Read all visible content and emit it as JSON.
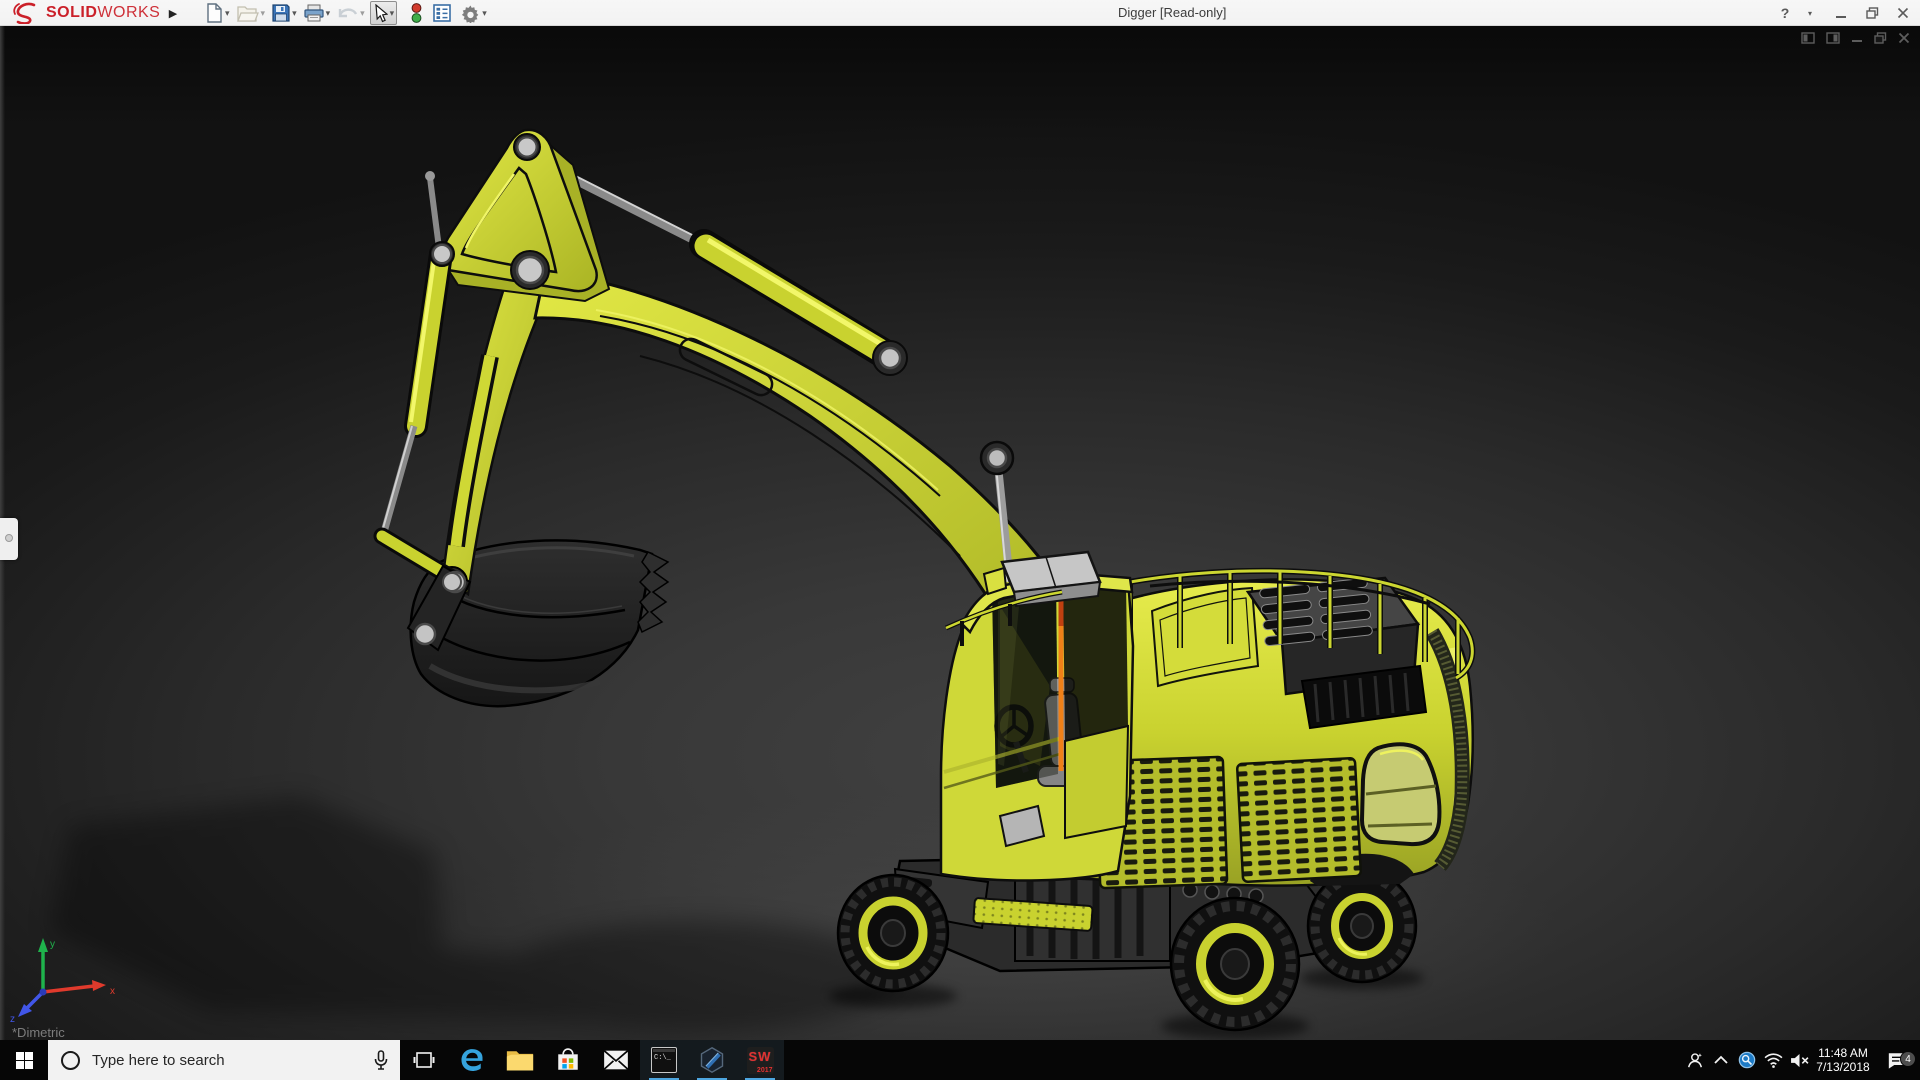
{
  "titlebar": {
    "logo": {
      "bold": "SOLID",
      "light": "WORKS"
    },
    "flyout_glyph": "▶",
    "dropdown_glyph": "▾",
    "title": "Digger [Read-only]",
    "tools": [
      "new-document",
      "open",
      "save",
      "print",
      "undo",
      "select",
      "rebuild-traffic-light",
      "file-properties",
      "options"
    ],
    "help_glyph": "?",
    "minimize_glyph": "–",
    "close_glyph": "✕"
  },
  "viewport": {
    "model_name": "Digger",
    "orientation_label": "*Dimetric",
    "doc_controls": [
      "pane-left",
      "pane-right",
      "minimize",
      "restore",
      "close"
    ],
    "triad": {
      "x_label": "x",
      "y_label": "y",
      "z_label": "z",
      "x_color": "#e03a2c",
      "y_color": "#1fb34c",
      "z_color": "#4156e8"
    }
  },
  "taskbar": {
    "search_placeholder": "Type here to search",
    "apps": [
      "task-view",
      "edge",
      "file-explorer",
      "microsoft-store",
      "mail",
      "command-prompt",
      "cad-viewer",
      "solidworks-2017"
    ],
    "running_apps": [
      "command-prompt",
      "cad-viewer",
      "solidworks-2017"
    ],
    "cmd_label": "C:\\_",
    "sw_label": "SW",
    "sw_year": "2017",
    "tray": {
      "time": "11:48 AM",
      "date": "7/13/2018",
      "notification_count": "4"
    }
  },
  "colors": {
    "machine_yellow": "#cdd632",
    "logo_red": "#cb2029",
    "stripe_orange": "#e87a18",
    "running_underline": "#4da6e0"
  }
}
